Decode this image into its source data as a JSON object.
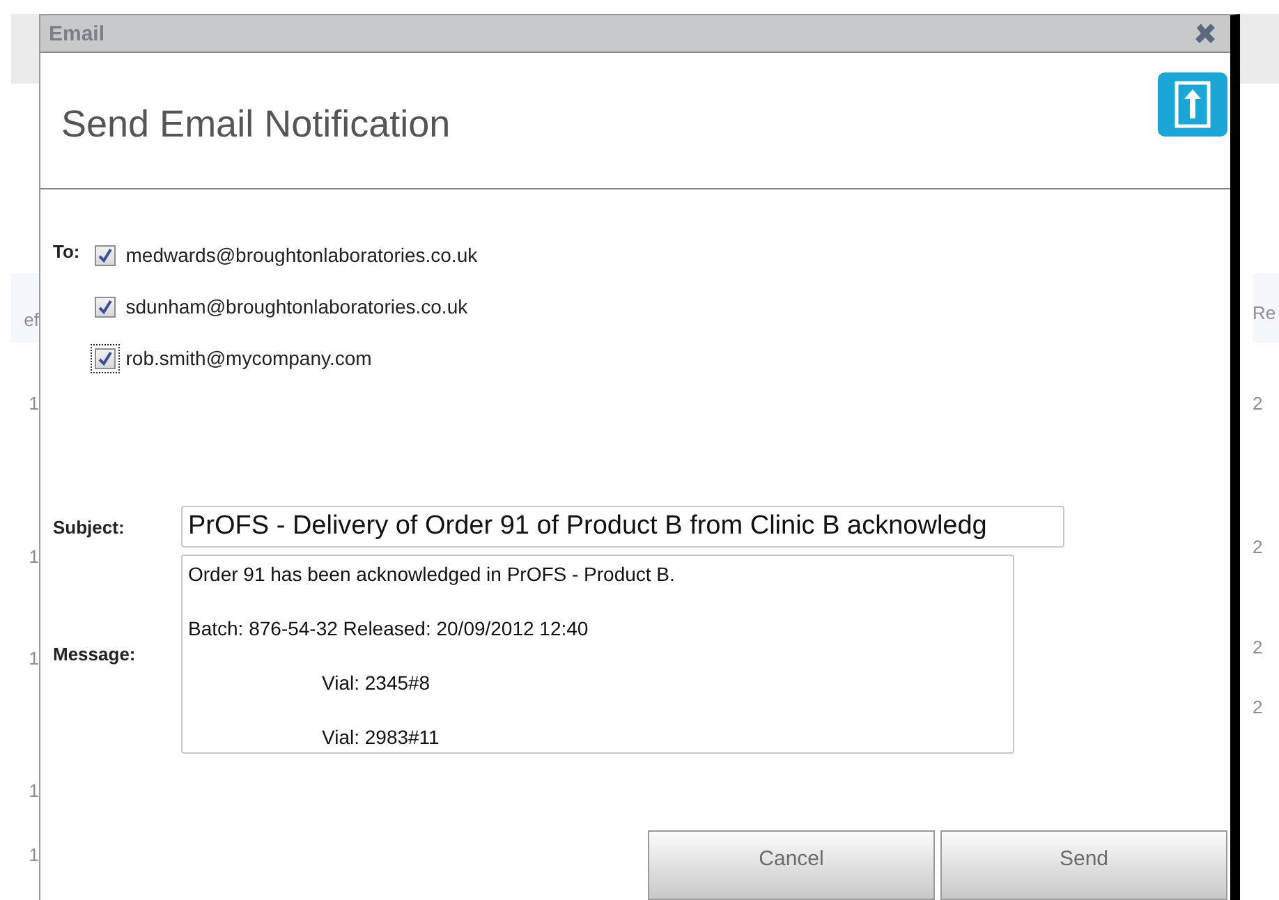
{
  "background": {
    "left_column": [
      "ef",
      "1",
      "1",
      "1",
      "1",
      "1"
    ],
    "right_column": [
      "Re",
      "2",
      "2",
      "2",
      "2"
    ]
  },
  "dialog": {
    "title": "Email",
    "heading": "Send Email Notification",
    "to_label": "To:",
    "recipients": [
      {
        "address": "medwards@broughtonlaboratories.co.uk",
        "checked": true,
        "focused": false
      },
      {
        "address": "sdunham@broughtonlaboratories.co.uk",
        "checked": true,
        "focused": false
      },
      {
        "address": "rob.smith@mycompany.com",
        "checked": true,
        "focused": true
      }
    ],
    "subject_label": "Subject:",
    "subject": "PrOFS - Delivery of Order 91 of Product B from Clinic B acknowledg",
    "message_label": "Message:",
    "message_lines": [
      {
        "text": "Order 91 has been acknowledged in PrOFS  - Product B.",
        "indented": false
      },
      {
        "text": "Batch: 876-54-32 Released: 20/09/2012 12:40",
        "indented": false
      },
      {
        "text": "Vial: 2345#8",
        "indented": true
      },
      {
        "text": "Vial: 2983#11",
        "indented": true
      }
    ],
    "buttons": [
      "Cancel",
      "Send"
    ]
  }
}
